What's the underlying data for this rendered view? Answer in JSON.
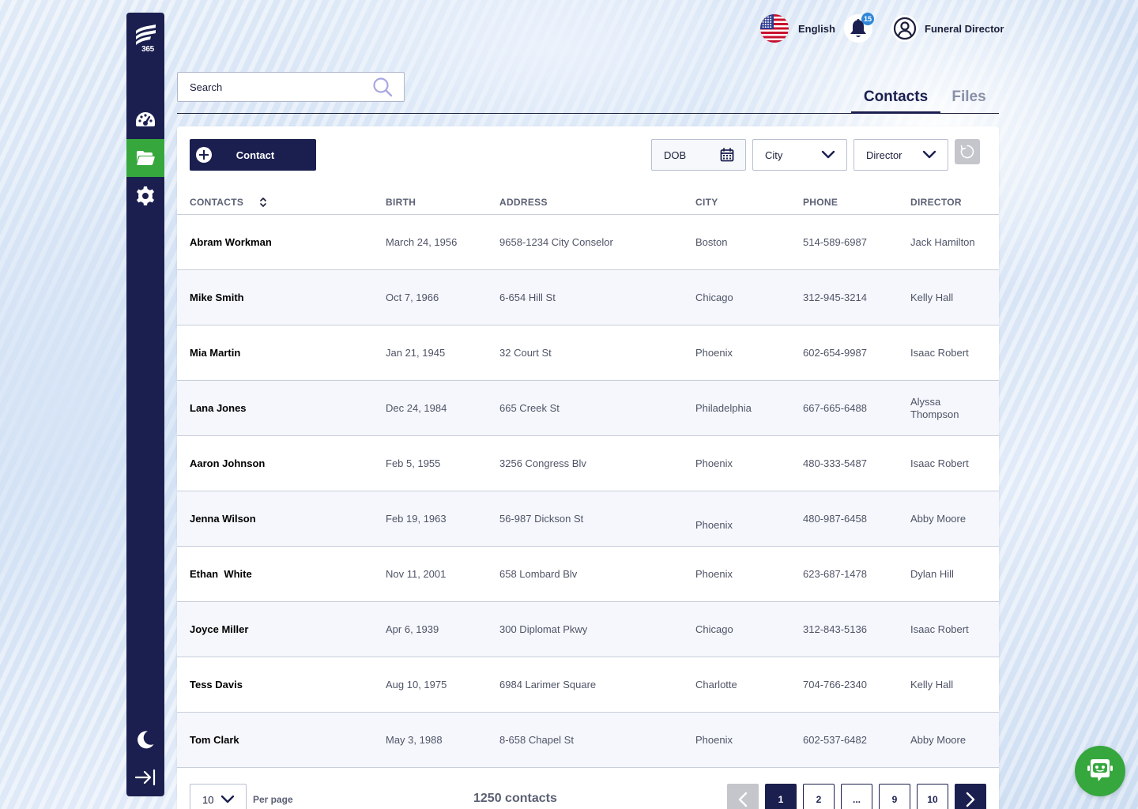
{
  "app": {
    "logo_text": "365"
  },
  "colors": {
    "navy": "#1b1f4f",
    "green": "#35a73d",
    "badge_blue": "#2f87d8"
  },
  "sidebar": {
    "items": [
      {
        "name": "dashboard",
        "icon": "speedometer-icon",
        "active": false
      },
      {
        "name": "contacts",
        "icon": "folder-icon",
        "active": true
      },
      {
        "name": "settings",
        "icon": "gear-icon",
        "active": false
      }
    ],
    "bottom": [
      {
        "name": "dark-mode",
        "icon": "moon-icon"
      },
      {
        "name": "collapse",
        "icon": "arrow-to-right-icon"
      }
    ]
  },
  "header": {
    "language": "English",
    "language_icon": "us-flag-icon",
    "notifications_count": "15",
    "user_role": "Funeral Director"
  },
  "search": {
    "placeholder": "Search"
  },
  "tabs": [
    {
      "label": "Contacts",
      "active": true
    },
    {
      "label": "Files",
      "active": false
    }
  ],
  "toolbar": {
    "add_label": "Contact",
    "filters": {
      "dob": "DOB",
      "city": "City",
      "director": "Director"
    }
  },
  "table": {
    "columns": [
      "CONTACTS",
      "BIRTH",
      "ADDRESS",
      "CITY",
      "PHONE",
      "DIRECTOR"
    ],
    "rows": [
      {
        "name": "Abram Workman",
        "birth": "March 24, 1956",
        "address": "9658-1234 City Conselor",
        "city": "Boston",
        "phone": "514-589-6987",
        "director": "Jack Hamilton"
      },
      {
        "name": "Mike Smith",
        "birth": "Oct 7, 1966",
        "address": "6-654 Hill St",
        "city": "Chicago",
        "phone": "312-945-3214",
        "director": "Kelly Hall"
      },
      {
        "name": "Mia Martin",
        "birth": "Jan 21, 1945",
        "address": "32 Court St",
        "city": "Phoenix",
        "phone": "602-654-9987",
        "director": "Isaac Robert"
      },
      {
        "name": "Lana Jones",
        "birth": "Dec 24, 1984",
        "address": "665 Creek St",
        "city": "Philadelphia",
        "phone": "667-665-6488",
        "director": "Alyssa Thompson"
      },
      {
        "name": "Aaron Johnson",
        "birth": "Feb 5, 1955",
        "address": "3256 Congress Blv",
        "city": "Phoenix",
        "phone": "480-333-5487",
        "director": "Isaac Robert"
      },
      {
        "name": "Jenna Wilson",
        "birth": "Feb 19, 1963",
        "address": "56-987 Dickson St",
        "city": "Phoenix",
        "phone": "480-987-6458",
        "director": "Abby Moore"
      },
      {
        "name": "Ethan  White",
        "birth": "Nov 11, 2001",
        "address": "658 Lombard Blv",
        "city": "Phoenix",
        "phone": "623-687-1478",
        "director": "Dylan Hill"
      },
      {
        "name": "Joyce Miller",
        "birth": "Apr 6, 1939",
        "address": "300 Diplomat Pkwy",
        "city": "Chicago",
        "phone": "312-843-5136",
        "director": "Isaac Robert"
      },
      {
        "name": "Tess Davis",
        "birth": "Aug 10, 1975",
        "address": "6984 Larimer Square",
        "city": "Charlotte",
        "phone": "704-766-2340",
        "director": "Kelly Hall"
      },
      {
        "name": "Tom Clark",
        "birth": "May 3, 1988",
        "address": "8-658 Chapel St",
        "city": "Phoenix",
        "phone": "602-537-6482",
        "director": "Abby Moore"
      }
    ]
  },
  "footer": {
    "per_page_value": "10",
    "per_page_label": "Per page",
    "total": "1250 contacts",
    "pages": [
      "1",
      "2",
      "...",
      "9",
      "10"
    ],
    "current_page": "1"
  }
}
